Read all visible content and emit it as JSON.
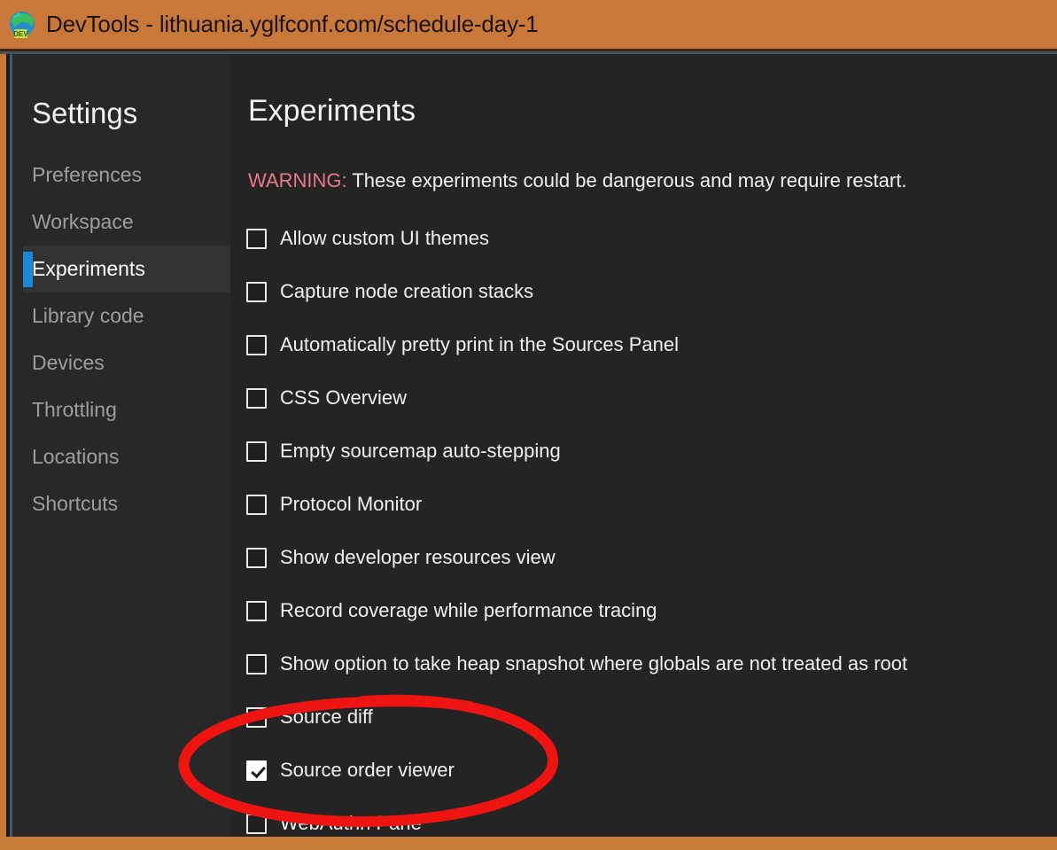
{
  "window": {
    "title": "DevTools - lithuania.yglfconf.com/schedule-day-1",
    "icon": "edge-dev-browser-icon",
    "titlebar_color": "#c8793a"
  },
  "sidebar": {
    "heading": "Settings",
    "items": [
      {
        "label": "Preferences",
        "selected": false
      },
      {
        "label": "Workspace",
        "selected": false
      },
      {
        "label": "Experiments",
        "selected": true
      },
      {
        "label": "Library code",
        "selected": false
      },
      {
        "label": "Devices",
        "selected": false
      },
      {
        "label": "Throttling",
        "selected": false
      },
      {
        "label": "Locations",
        "selected": false
      },
      {
        "label": "Shortcuts",
        "selected": false
      }
    ],
    "accent_color": "#1b8ad6"
  },
  "main": {
    "title": "Experiments",
    "warning_label": "WARNING:",
    "warning_text": " These experiments could be dangerous and may require restart.",
    "warning_color": "#e8798c",
    "experiments": [
      {
        "label": "Allow custom UI themes",
        "checked": false
      },
      {
        "label": "Capture node creation stacks",
        "checked": false
      },
      {
        "label": "Automatically pretty print in the Sources Panel",
        "checked": false
      },
      {
        "label": "CSS Overview",
        "checked": false
      },
      {
        "label": "Empty sourcemap auto-stepping",
        "checked": false
      },
      {
        "label": "Protocol Monitor",
        "checked": false
      },
      {
        "label": "Show developer resources view",
        "checked": false
      },
      {
        "label": "Record coverage while performance tracing",
        "checked": false
      },
      {
        "label": "Show option to take heap snapshot where globals are not treated as root",
        "checked": false
      },
      {
        "label": "Source diff",
        "checked": false
      },
      {
        "label": "Source order viewer",
        "checked": true
      },
      {
        "label": "WebAuthn Pane",
        "checked": false
      }
    ]
  },
  "annotation": {
    "type": "hand-drawn-ellipse",
    "color": "#ee1412",
    "targets": "Source order viewer"
  }
}
